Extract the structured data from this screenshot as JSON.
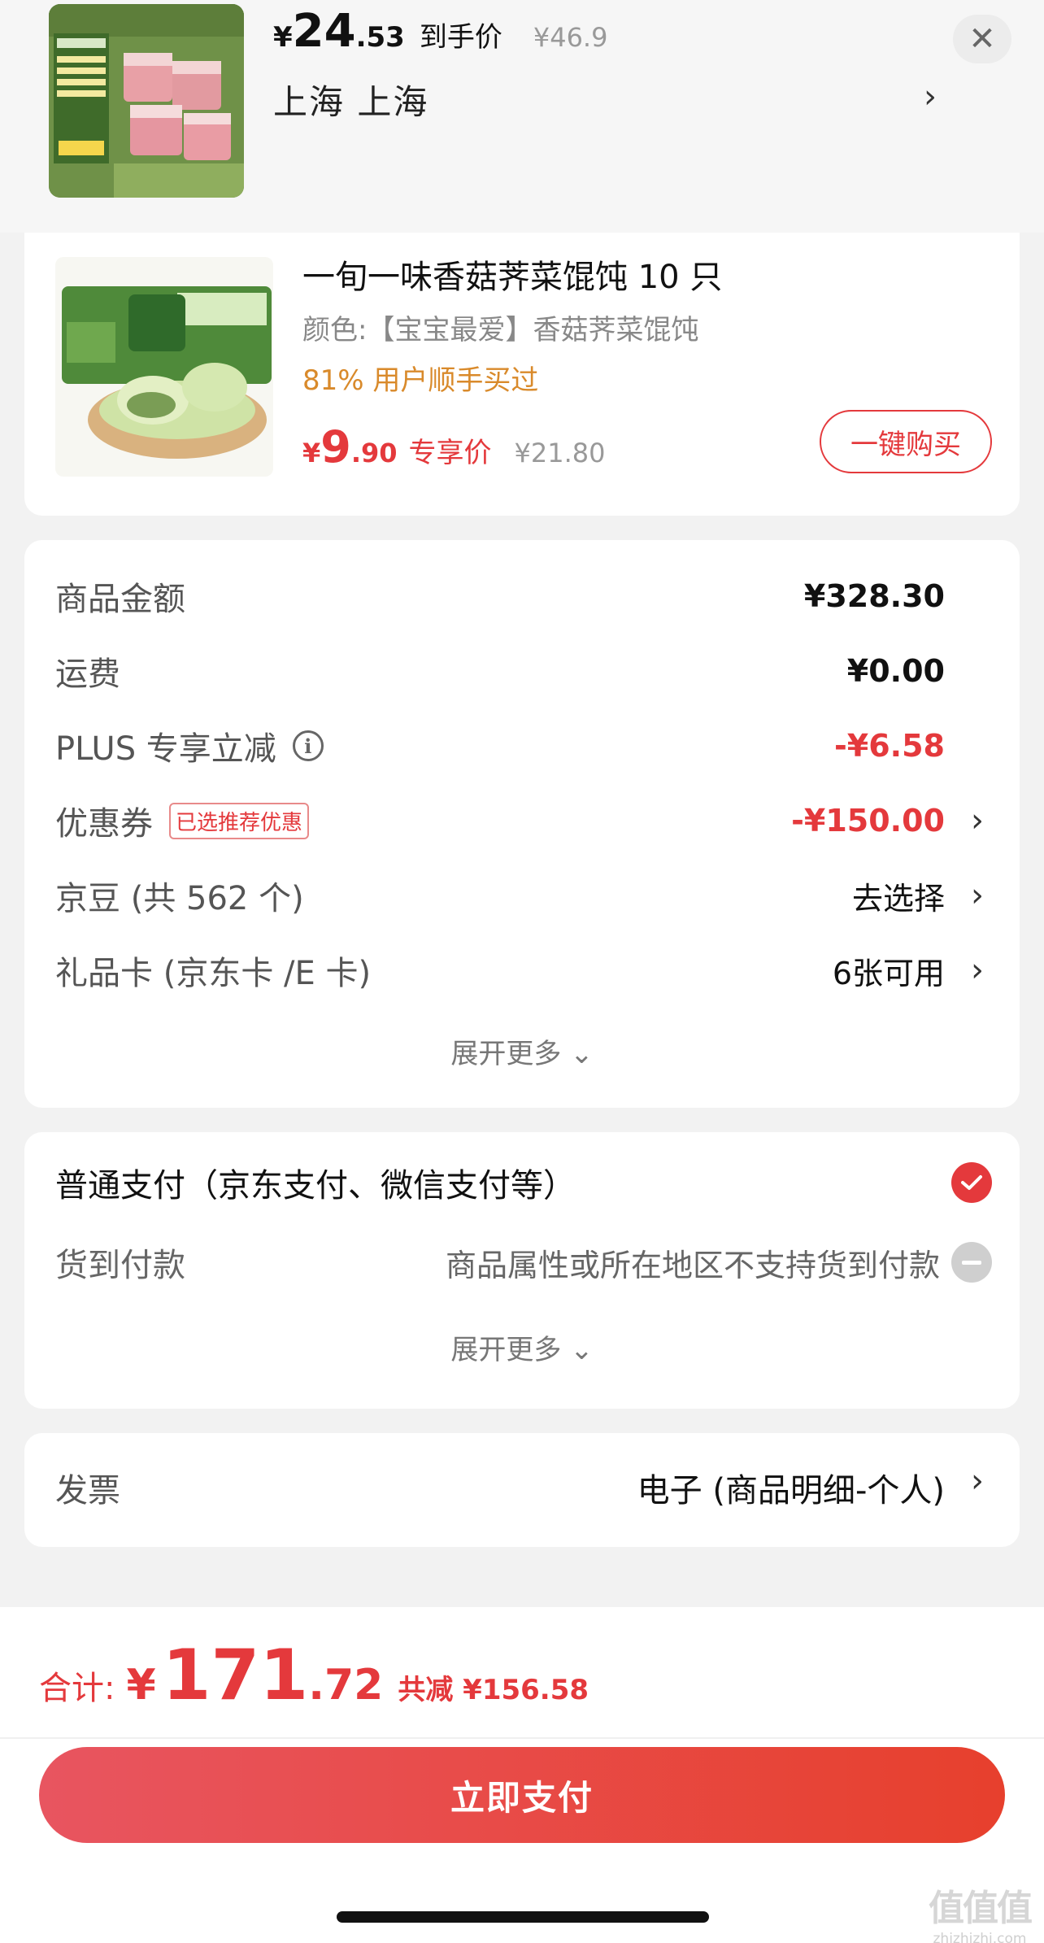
{
  "top_bar": {
    "price_yen": "¥",
    "price_int": "24",
    "price_dec": ".53",
    "price_tag": "到手价",
    "orig_price": "¥46.9",
    "location": "上海  上海",
    "close_glyph": "✕",
    "loc_arrow": "›"
  },
  "recommend": {
    "title": "一旬一味香菇荠菜馄饨 10 只",
    "spec": "颜色:【宝宝最爱】香菇荠菜馄饨",
    "stat": "81% 用户顺手买过",
    "price_yen": "¥",
    "price_int": "9",
    "price_dec": ".90",
    "price_tag": "专享价",
    "orig_price": "¥21.80",
    "buy_button": "一键购买"
  },
  "amounts": {
    "goods_label": "商品金额",
    "goods_value": "¥328.30",
    "shipping_label": "运费",
    "shipping_value": "¥0.00",
    "plus_label": "PLUS 专享立减",
    "plus_value": "-¥6.58",
    "coupon_label": "优惠券",
    "coupon_badge": "已选推荐优惠",
    "coupon_value": "-¥150.00",
    "jingdou_label": "京豆 (共 562 个)",
    "jingdou_value": "去选择",
    "giftcard_label": "礼品卡 (京东卡 /E 卡)",
    "giftcard_value": "6张可用",
    "expand_more": "展开更多 ⌄",
    "arrow": "›"
  },
  "payment": {
    "normal_label": "普通支付（京东支付、微信支付等）",
    "cod_label": "货到付款",
    "cod_note": "商品属性或所在地区不支持货到付款",
    "expand_more": "展开更多 ⌄"
  },
  "invoice": {
    "label": "发票",
    "value": "电子 (商品明细-个人)",
    "arrow": "›"
  },
  "bottom": {
    "total_label": "合计:",
    "total_yen": "¥",
    "total_int": "171",
    "total_dec": ".72",
    "total_save": "共减 ¥156.58",
    "pay_button": "立即支付"
  },
  "watermark": {
    "glyphs": "值值值",
    "url": "zhizhizhi.com"
  },
  "colors": {
    "accent_red": "#e4393c",
    "orange": "#d98a2b",
    "background": "#f2f2f2"
  }
}
